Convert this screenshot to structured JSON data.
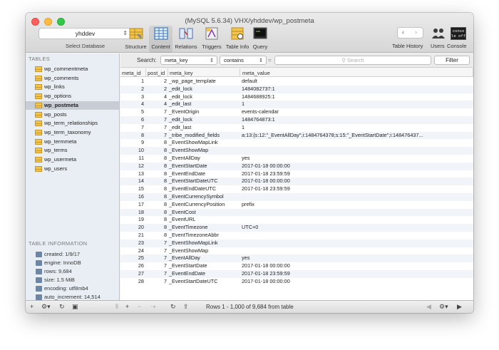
{
  "window": {
    "title": "(MySQL 5.6.34) VHX/yhddev/wp_postmeta"
  },
  "database": {
    "selected": "yhddev",
    "label": "Select Database"
  },
  "toolbar": {
    "items": [
      {
        "label": "Structure",
        "icon": "structure-icon"
      },
      {
        "label": "Content",
        "icon": "content-icon"
      },
      {
        "label": "Relations",
        "icon": "relations-icon"
      },
      {
        "label": "Triggers",
        "icon": "triggers-icon"
      },
      {
        "label": "Table Info",
        "icon": "table-info-icon"
      },
      {
        "label": "Query",
        "icon": "query-icon"
      }
    ],
    "active": "Content",
    "history_label": "Table History",
    "users_label": "Users",
    "console_label": "Console",
    "console_badge": "conso le off"
  },
  "sidebar": {
    "tables_heading": "TABLES",
    "tables": [
      "wp_commentmeta",
      "wp_comments",
      "wp_links",
      "wp_options",
      "wp_postmeta",
      "wp_posts",
      "wp_term_relationships",
      "wp_term_taxonomy",
      "wp_termmeta",
      "wp_terms",
      "wp_usermeta",
      "wp_users"
    ],
    "selected_table": "wp_postmeta",
    "info_heading": "TABLE INFORMATION",
    "info": [
      "created: 1/9/17",
      "engine: InnoDB",
      "rows: 9,684",
      "size: 1.5 MiB",
      "encoding: utf8mb4",
      "auto_increment: 14,514"
    ]
  },
  "filter": {
    "search_label": "Search:",
    "field": "meta_key",
    "operator": "contains",
    "equals_symbol": "=",
    "search_placeholder": "Search",
    "filter_button": "Filter"
  },
  "grid": {
    "columns": [
      "meta_id",
      "post_id",
      "meta_key",
      "meta_value"
    ],
    "rows": [
      [
        "1",
        "2",
        "_wp_page_template",
        "default"
      ],
      [
        "2",
        "2",
        "_edit_lock",
        "1484082737:1"
      ],
      [
        "3",
        "4",
        "_edit_lock",
        "1484688925:1"
      ],
      [
        "4",
        "4",
        "_edit_last",
        "1"
      ],
      [
        "5",
        "7",
        "_EventOrigin",
        "events-calendar"
      ],
      [
        "6",
        "7",
        "_edit_lock",
        "1484764873:1"
      ],
      [
        "7",
        "7",
        "_edit_last",
        "1"
      ],
      [
        "8",
        "7",
        "_tribe_modified_fields",
        "a:13:{s:12:\"_EventAllDay\";i:1484764378;s:15:\"_EventStartDate\";i:148476437..."
      ],
      [
        "9",
        "8",
        "_EventShowMapLink",
        ""
      ],
      [
        "10",
        "8",
        "_EventShowMap",
        ""
      ],
      [
        "11",
        "8",
        "_EventAllDay",
        "yes"
      ],
      [
        "12",
        "8",
        "_EventStartDate",
        "2017-01-18 00:00:00"
      ],
      [
        "13",
        "8",
        "_EventEndDate",
        "2017-01-18 23:59:59"
      ],
      [
        "14",
        "8",
        "_EventStartDateUTC",
        "2017-01-18 00:00:00"
      ],
      [
        "15",
        "8",
        "_EventEndDateUTC",
        "2017-01-18 23:59:59"
      ],
      [
        "16",
        "8",
        "_EventCurrencySymbol",
        ""
      ],
      [
        "17",
        "8",
        "_EventCurrencyPosition",
        "prefix"
      ],
      [
        "18",
        "8",
        "_EventCost",
        ""
      ],
      [
        "19",
        "8",
        "_EventURL",
        ""
      ],
      [
        "20",
        "8",
        "_EventTimezone",
        "UTC+0"
      ],
      [
        "21",
        "8",
        "_EventTimezoneAbbr",
        ""
      ],
      [
        "23",
        "7",
        "_EventShowMapLink",
        ""
      ],
      [
        "24",
        "7",
        "_EventShowMap",
        ""
      ],
      [
        "25",
        "7",
        "_EventAllDay",
        "yes"
      ],
      [
        "26",
        "7",
        "_EventStartDate",
        "2017-01-18 00:00:00"
      ],
      [
        "27",
        "7",
        "_EventEndDate",
        "2017-01-18 23:59:59"
      ],
      [
        "28",
        "7",
        "_EventStartDateUTC",
        "2017-01-18 00:00:00"
      ]
    ]
  },
  "status": {
    "rows_text": "Rows 1 - 1,000 of 9,684 from table"
  },
  "colors": {
    "selected_row": "#c8ccd4",
    "sidebar_bg": "#e9eef4",
    "alt_row": "#f1f5fa",
    "table_icon": "#f3c44a"
  }
}
